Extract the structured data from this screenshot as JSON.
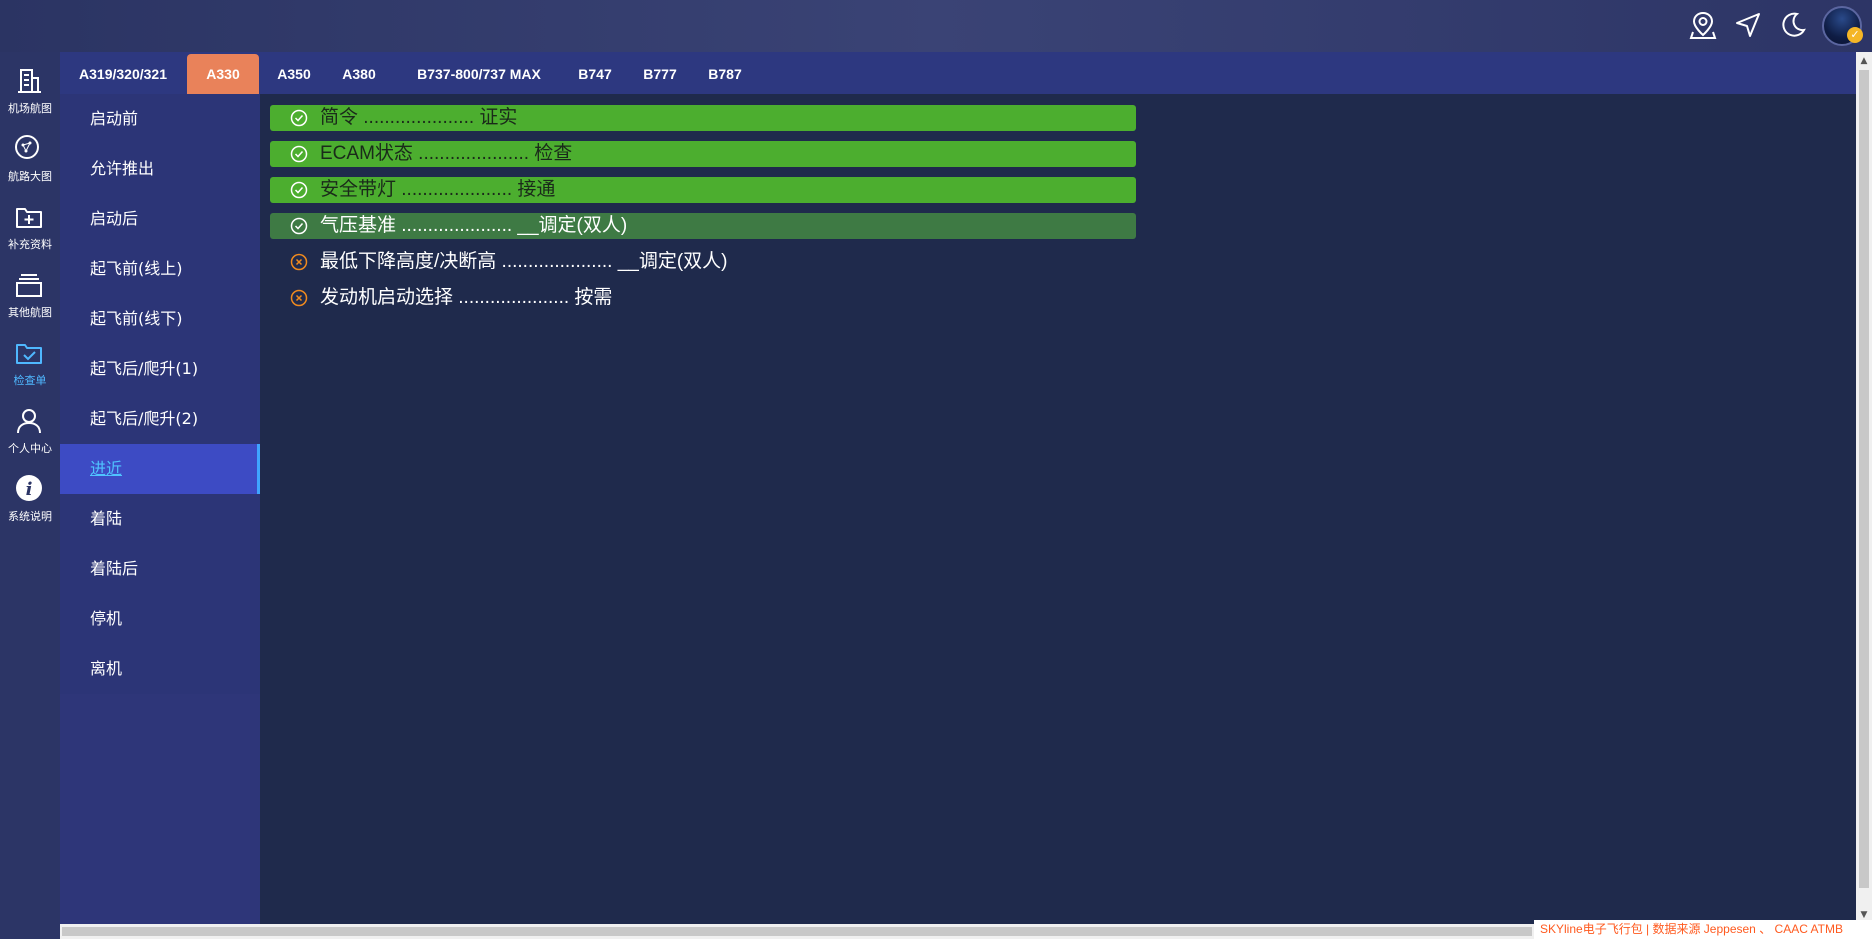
{
  "topbar": {
    "icons": [
      "map-pin-icon",
      "navigation-icon",
      "moon-icon"
    ],
    "avatar_badge": "✓"
  },
  "leftnav": [
    {
      "label": "机场航图",
      "icon": "building-icon",
      "active": false
    },
    {
      "label": "航路大图",
      "icon": "route-map-icon",
      "active": false
    },
    {
      "label": "补充资料",
      "icon": "folder-plus-icon",
      "active": false
    },
    {
      "label": "其他航图",
      "icon": "layers-icon",
      "active": false
    },
    {
      "label": "检查单",
      "icon": "folder-check-icon",
      "active": true
    },
    {
      "label": "个人中心",
      "icon": "user-icon",
      "active": false
    },
    {
      "label": "系统说明",
      "icon": "info-icon",
      "active": false
    }
  ],
  "tabs": [
    {
      "label": "A319/320/321",
      "active": false
    },
    {
      "label": "A330",
      "active": true
    },
    {
      "label": "A350",
      "active": false
    },
    {
      "label": "A380",
      "active": false
    },
    {
      "label": "B737-800/737 MAX",
      "active": false
    },
    {
      "label": "B747",
      "active": false
    },
    {
      "label": "B777",
      "active": false
    },
    {
      "label": "B787",
      "active": false
    }
  ],
  "menu": [
    {
      "label": "启动前",
      "active": false
    },
    {
      "label": "允许推出",
      "active": false
    },
    {
      "label": "启动后",
      "active": false
    },
    {
      "label": "起飞前(线上)",
      "active": false
    },
    {
      "label": "起飞前(线下)",
      "active": false
    },
    {
      "label": "起飞后/爬升(1)",
      "active": false
    },
    {
      "label": "起飞后/爬升(2)",
      "active": false
    },
    {
      "label": "进近",
      "active": true
    },
    {
      "label": "着陆",
      "active": false
    },
    {
      "label": "着陆后",
      "active": false
    },
    {
      "label": "停机",
      "active": false
    },
    {
      "label": "离机",
      "active": false
    }
  ],
  "checklist": [
    {
      "text": "简令 ..................... 证实",
      "status": "done"
    },
    {
      "text": "ECAM状态 ..................... 检查",
      "status": "done"
    },
    {
      "text": "安全带灯 ..................... 接通",
      "status": "done"
    },
    {
      "text": "气压基准 ..................... __调定(双人)",
      "status": "current"
    },
    {
      "text": "最低下降高度/决断高 ..................... __调定(双人)",
      "status": "pending"
    },
    {
      "text": "发动机启动选择 ..................... 按需",
      "status": "pending"
    }
  ],
  "colors": {
    "tab_active": "#e9825a",
    "row_done": "#4cae2f",
    "row_current": "#3e7a44",
    "pending_icon": "#f08a1e",
    "nav_active": "#4fb8ff",
    "footer_text": "#ff5a1f"
  },
  "footer": "SKYline电子飞行包 | 数据来源 Jeppesen 、 CAAC ATMB"
}
